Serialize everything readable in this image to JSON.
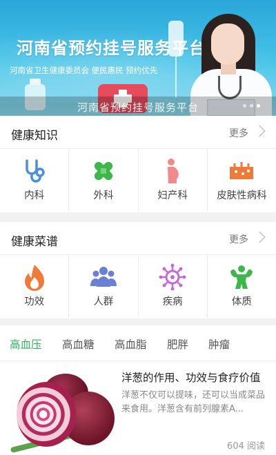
{
  "banner": {
    "title": "河南省预约挂号服务平台",
    "subtitle": "河南省卫生健康委员会  便民惠民  预约优先",
    "caption": "河南省预约挂号服务平台"
  },
  "health_knowledge": {
    "title": "健康知识",
    "more": "更多",
    "items": [
      {
        "label": "内科",
        "icon": "stethoscope-icon",
        "color": "#4a90d9"
      },
      {
        "label": "外科",
        "icon": "bandage-icon",
        "color": "#3cb84a"
      },
      {
        "label": "妇产科",
        "icon": "pregnancy-icon",
        "color": "#f08a8a"
      },
      {
        "label": "皮肤性病科",
        "icon": "skin-icon",
        "color": "#f07a3a"
      }
    ]
  },
  "health_recipes": {
    "title": "健康菜谱",
    "more": "更多",
    "items": [
      {
        "label": "功效",
        "icon": "flame-icon",
        "color": "#f07a3a"
      },
      {
        "label": "人群",
        "icon": "people-icon",
        "color": "#6a7fd6"
      },
      {
        "label": "疾病",
        "icon": "virus-icon",
        "color": "#c46ad6"
      },
      {
        "label": "体质",
        "icon": "muscle-icon",
        "color": "#3cb84a"
      }
    ]
  },
  "tabs": [
    "高血压",
    "高血糖",
    "高血脂",
    "肥胖",
    "肿瘤"
  ],
  "active_tab": "高血压",
  "accent_color": "#2db35d",
  "article": {
    "title": "洋葱的作用、功效与食疗价值",
    "description": "洋葱不仅可以提味，还可以当成菜品来食用。洋葱含有前列腺素A...",
    "views": "604 阅读"
  }
}
